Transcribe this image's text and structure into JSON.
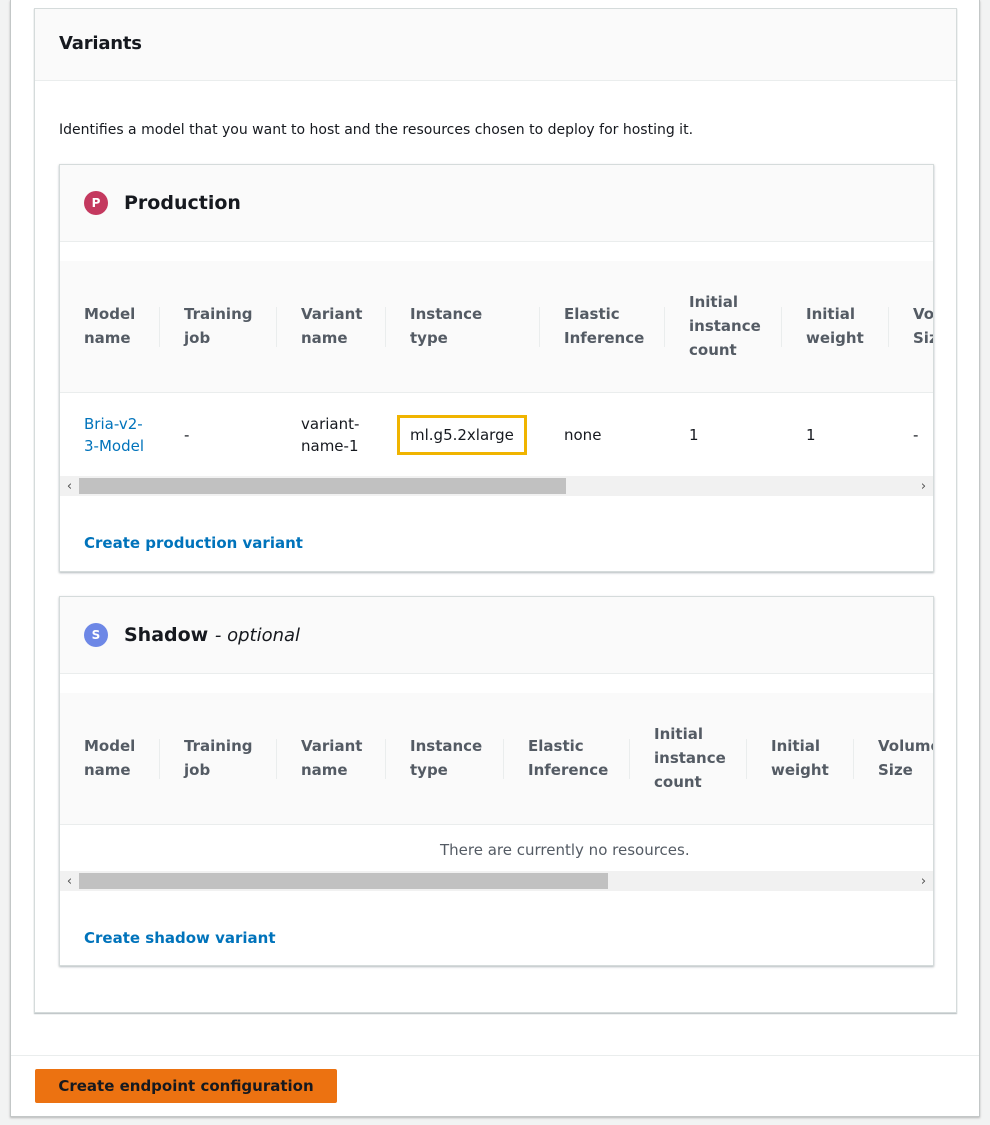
{
  "section": {
    "title": "Variants",
    "description": "Identifies a model that you want to host and the resources chosen to deploy for hosting it."
  },
  "production": {
    "badge": "P",
    "title": "Production",
    "columns": [
      "Model name",
      "Training job",
      "Variant name",
      "Instance type",
      "Elastic Inference",
      "Initial instance count",
      "Initial weight",
      "Volume Size"
    ],
    "rows": [
      {
        "model_name": "Bria-v2-3-Model",
        "training_job": "-",
        "variant_name": "variant-name-1",
        "instance_type": "ml.g5.2xlarge",
        "elastic_inference": "none",
        "initial_instance_count": "1",
        "initial_weight": "1",
        "volume_size": "-"
      }
    ],
    "action_label": "Create production variant",
    "highlight_color": "#f0b400"
  },
  "shadow": {
    "badge": "S",
    "title": "Shadow",
    "title_suffix": "- optional",
    "columns": [
      "Model name",
      "Training job",
      "Variant name",
      "Instance type",
      "Elastic Inference",
      "Initial instance count",
      "Initial weight",
      "Volume Size"
    ],
    "empty_text": "There are currently no resources.",
    "action_label": "Create shadow variant"
  },
  "footer": {
    "primary_button": "Create endpoint configuration",
    "primary_color": "#ec7211"
  },
  "icons": {
    "scroll_left": "‹",
    "scroll_right": "›"
  }
}
